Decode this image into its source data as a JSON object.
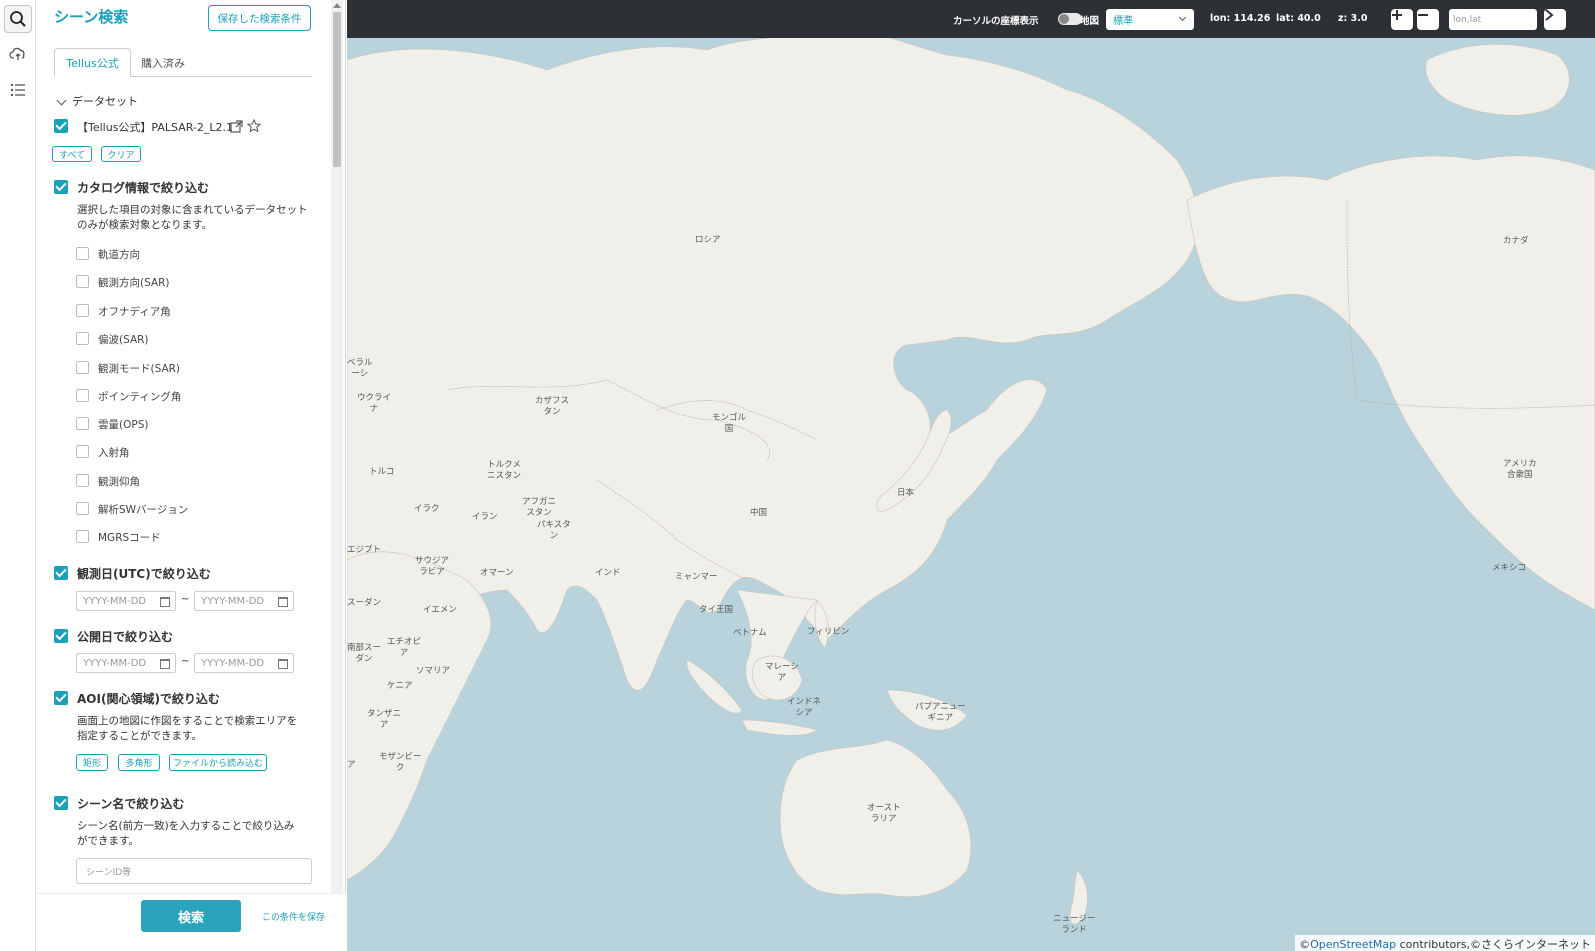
{
  "rail": {
    "items": [
      {
        "name": "search",
        "icon": "search-icon",
        "active": true
      },
      {
        "name": "cloud-upload",
        "icon": "cloud-upload-icon",
        "active": false
      },
      {
        "name": "list",
        "icon": "list-icon",
        "active": false
      }
    ]
  },
  "panel": {
    "title": "シーン検索",
    "saved_button": "保存した検索条件",
    "tabs": [
      {
        "label": "Tellus公式",
        "active": true
      },
      {
        "label": "購入済み",
        "active": false
      }
    ],
    "dataset_heading": "データセット",
    "dataset": {
      "name": "【Tellus公式】PALSAR-2_L2.1",
      "checked": true,
      "select_all": "すべて",
      "clear": "クリア"
    },
    "catalog": {
      "title": "カタログ情報で絞り込む",
      "checked": true,
      "description_line1": "選択した項目の対象に含まれているデータセット",
      "description_line2": "のみが検索対象となります。",
      "items": [
        "軌道方向",
        "観測方向(SAR)",
        "オフナディア角",
        "偏波(SAR)",
        "観測モード(SAR)",
        "ポインティング角",
        "雲量(OPS)",
        "入射角",
        "観測仰角",
        "解析SWバージョン",
        "MGRSコード"
      ]
    },
    "observation_date": {
      "title": "観測日(UTC)で絞り込む",
      "checked": true,
      "from_placeholder": "YYYY-MM-DD",
      "to_placeholder": "YYYY-MM-DD",
      "separator": "~"
    },
    "publication_date": {
      "title": "公開日で絞り込む",
      "checked": true,
      "from_placeholder": "YYYY-MM-DD",
      "to_placeholder": "YYYY-MM-DD",
      "separator": "~"
    },
    "aoi": {
      "title": "AOI(関心領域)で絞り込む",
      "checked": true,
      "description_line1": "画面上の地図に作図をすることで検索エリアを",
      "description_line2": "指定することができます。",
      "buttons": [
        "矩形",
        "多角形",
        "ファイルから読み込む"
      ]
    },
    "scene_name": {
      "title": "シーン名で絞り込む",
      "checked": true,
      "description_line1": "シーン名(前方一致)を入力することで絞り込み",
      "description_line2": "ができます。",
      "placeholder": "シーンID等"
    },
    "search_button": "検索",
    "save_condition": "この条件を保存"
  },
  "map_toolbar": {
    "cursor_coords_label": "カーソルの座標表示",
    "cursor_coords_enabled": false,
    "map_label": "地図",
    "map_style": "標準",
    "lon": "lon: 114.26",
    "lat": "lat: 40.0",
    "zoom": "z: 3.0",
    "coord_placeholder": "lon,lat"
  },
  "map_labels": [
    "ロシア",
    "カナダ",
    "カザフス\nタン",
    "モンゴル\n国",
    "中国",
    "日本",
    "トルクメ\nニスタン",
    "アフガニ\nスタン",
    "パキスタ\nン",
    "インド",
    "イラン",
    "イラク",
    "トルコ",
    "ウクライ\nナ",
    "サウジア\nラビア",
    "オマーン",
    "イエメン",
    "エチオピ\nア",
    "ソマリア",
    "ケニア",
    "タンザニ\nア",
    "モザンビー\nク",
    "ミャンマー",
    "タイ王国",
    "ベトナム",
    "フィリピン",
    "マレーシ\nア",
    "インドネ\nシア",
    "パプアニュー\nギニア",
    "オースト\nラリア",
    "ニュージー\nランド",
    "アメリカ\n合衆国",
    "メキシコ",
    "ベラル\nーシ",
    "エジプト",
    "スーダン",
    "南部スー\nダン",
    "ア"
  ],
  "attribution": {
    "prefix": "©",
    "link": "OpenStreetMap",
    "suffix": " contributors,©さくらインターネット"
  },
  "colors": {
    "accent": "#1aa0b8",
    "search_button": "#2aa3bb",
    "toolbar": "#2d3135",
    "water": "#b9d3dc",
    "land": "#f1efe9"
  }
}
